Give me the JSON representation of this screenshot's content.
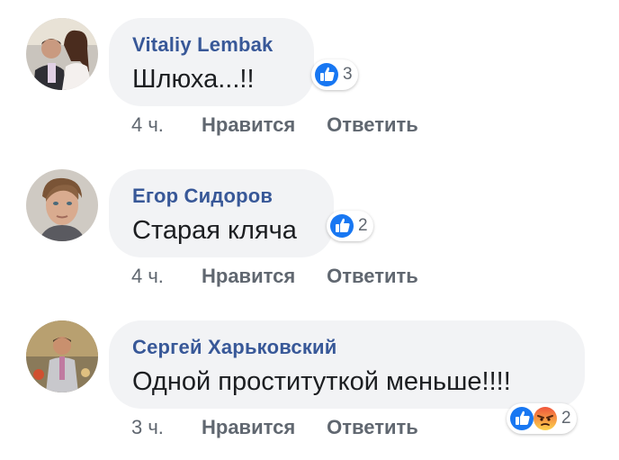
{
  "comments": [
    {
      "author": "Vitaliy Lembak",
      "text": "Шлюха...!!",
      "reactions": [
        "like-icon"
      ],
      "reaction_count": "3",
      "time": "4 ч.",
      "like_label": "Нравится",
      "reply_label": "Ответить"
    },
    {
      "author": "Егор Сидоров",
      "text": "Старая кляча",
      "reactions": [
        "like-icon"
      ],
      "reaction_count": "2",
      "time": "4 ч.",
      "like_label": "Нравится",
      "reply_label": "Ответить"
    },
    {
      "author": "Сергей Харьковский",
      "text": "Одной проституткой меньше!!!!",
      "reactions": [
        "like-icon",
        "angry-icon"
      ],
      "reaction_count": "2",
      "time": "3 ч.",
      "like_label": "Нравится",
      "reply_label": "Ответить"
    }
  ],
  "colors": {
    "author": "#385898",
    "bubble": "#f2f3f5",
    "like_reaction": "#1877f2",
    "meta": "#606770"
  }
}
